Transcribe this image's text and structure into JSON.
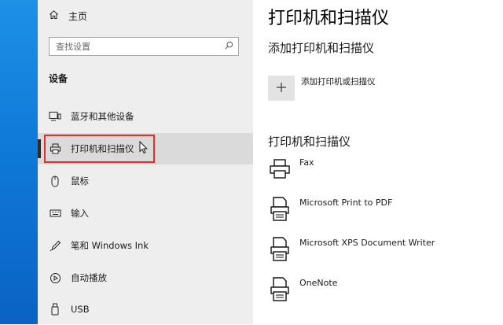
{
  "sidebar": {
    "home_label": "主页",
    "search_placeholder": "查找设置",
    "section_label": "设备",
    "items": [
      {
        "label": "蓝牙和其他设备"
      },
      {
        "label": "打印机和扫描仪"
      },
      {
        "label": "鼠标"
      },
      {
        "label": "输入"
      },
      {
        "label": "笔和 Windows Ink"
      },
      {
        "label": "自动播放"
      },
      {
        "label": "USB"
      }
    ],
    "selected_index": 1
  },
  "main": {
    "title": "打印机和扫描仪",
    "add_section_heading": "添加打印机和扫描仪",
    "add_button_label": "添加打印机或扫描仪",
    "list_heading": "打印机和扫描仪",
    "printers": [
      {
        "name": "Fax",
        "icon": "fax-icon"
      },
      {
        "name": "Microsoft Print to PDF",
        "icon": "printer-doc-icon"
      },
      {
        "name": "Microsoft XPS Document Writer",
        "icon": "printer-doc-icon"
      },
      {
        "name": "OneNote",
        "icon": "printer-doc-icon"
      }
    ]
  },
  "colors": {
    "highlight": "#e0302c",
    "sidebar_bg": "#eeeeee",
    "selected_bg": "#dadada"
  }
}
